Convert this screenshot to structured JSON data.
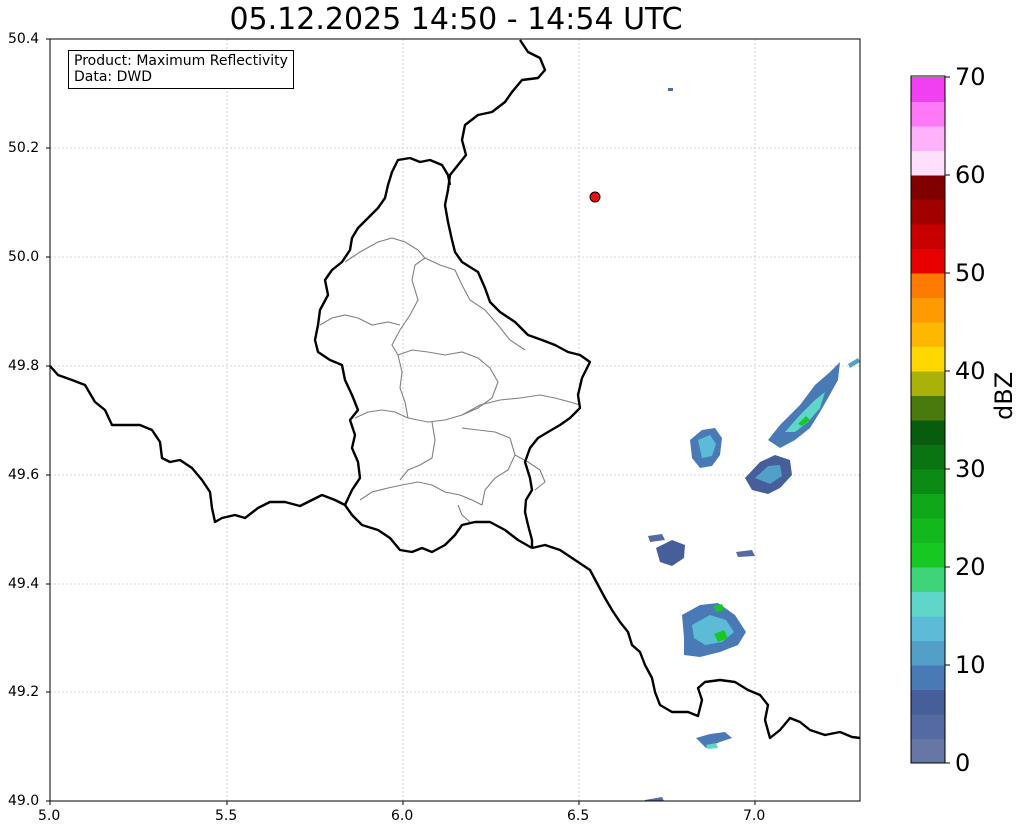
{
  "title": "05.12.2025 14:50 - 14:54 UTC",
  "info": {
    "product": "Product: Maximum Reflectivity",
    "data": "Data: DWD"
  },
  "x_ticks": [
    "5.0",
    "5.5",
    "6.0",
    "6.5",
    "7.0"
  ],
  "y_ticks": [
    "49.0",
    "49.2",
    "49.4",
    "49.6",
    "49.8",
    "50.0",
    "50.2",
    "50.4"
  ],
  "colorbar": {
    "unit": "dBZ",
    "tick_labels": [
      "0",
      "10",
      "20",
      "30",
      "40",
      "50",
      "60",
      "70"
    ],
    "colors": [
      "#6677a6",
      "#556aa0",
      "#465e9a",
      "#4a7ab5",
      "#52a0c8",
      "#5cbcd8",
      "#5ed6c8",
      "#40d47a",
      "#17c823",
      "#13b81c",
      "#10a81a",
      "#0c8a16",
      "#0a7412",
      "#085c0e",
      "#4a7a0e",
      "#aab20a",
      "#ffd800",
      "#ffb800",
      "#ff9a00",
      "#ff7a00",
      "#e80000",
      "#c80000",
      "#a00000",
      "#800000",
      "#ffe0fc",
      "#ffb2fa",
      "#ff78f8",
      "#f040f0"
    ]
  },
  "map": {
    "border_color": "#000000",
    "district_color": "#808080",
    "marker_color": "#e81010"
  }
}
